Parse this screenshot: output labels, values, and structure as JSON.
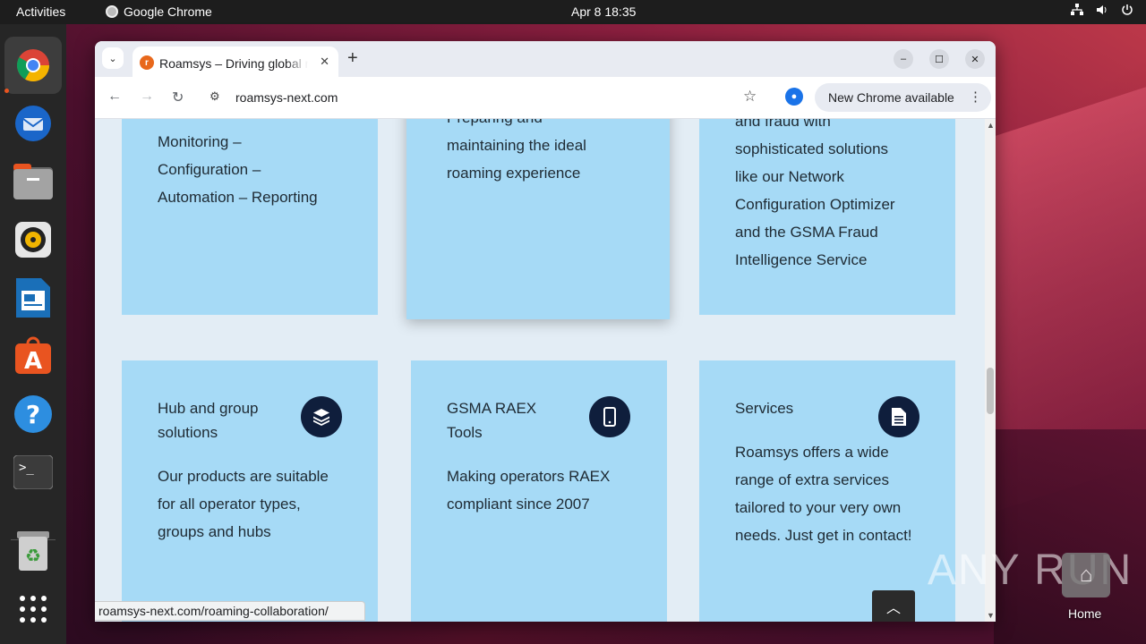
{
  "topbar": {
    "activities": "Activities",
    "app_name": "Google Chrome",
    "clock": "Apr 8  18:35"
  },
  "dock": {
    "items": [
      "chrome-icon",
      "thunderbird-icon",
      "files-icon",
      "rhythmbox-icon",
      "writer-icon",
      "software-icon",
      "help-icon",
      "terminal-icon",
      "trash-icon",
      "apps-grid-icon"
    ]
  },
  "browser": {
    "tab_title": "Roamsys – Driving global roaming",
    "url": "roamsys-next.com",
    "update_label": "New Chrome available",
    "status_url": "roamsys-next.com/roaming-collaboration/"
  },
  "cards_top": [
    {
      "lines": [
        "Monitoring –",
        "Configuration –",
        "Automation – Reporting"
      ]
    },
    {
      "lines": [
        "Preparing and",
        "maintaining the ideal",
        "roaming experience"
      ]
    },
    {
      "lines": [
        "and fraud with",
        "sophisticated solutions",
        "like our Network",
        "Configuration Optimizer",
        "and the GSMA Fraud",
        "Intelligence Service"
      ]
    }
  ],
  "cards_bottom": [
    {
      "title": "Hub and group solutions",
      "icon": "layers-icon",
      "lines": [
        "Our products are suitable",
        "for all operator types,",
        "groups and hubs"
      ]
    },
    {
      "title": "GSMA RAEX Tools",
      "icon": "mobile-icon",
      "lines": [
        "Making operators RAEX",
        "compliant since 2007"
      ]
    },
    {
      "title": "Services",
      "icon": "document-icon",
      "lines": [
        "Roamsys offers a wide",
        "range of extra services",
        "tailored to your very own",
        "needs. Just get in contact!"
      ]
    }
  ],
  "desktop": {
    "home_label": "Home",
    "watermark": "ANY RUN"
  }
}
